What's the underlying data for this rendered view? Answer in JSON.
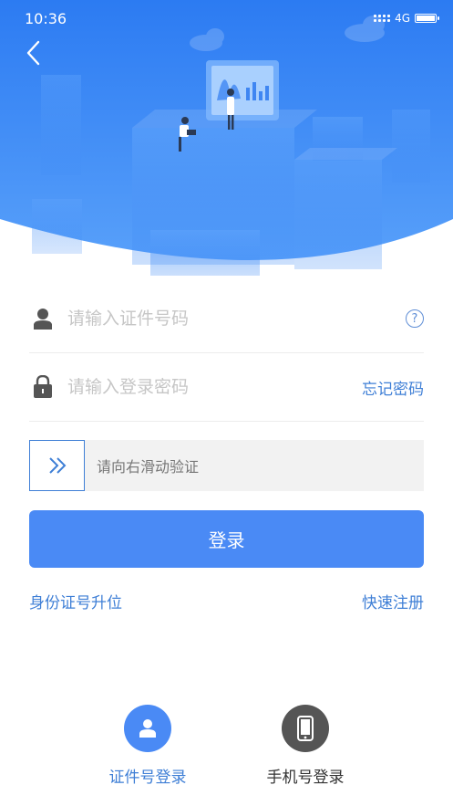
{
  "status_bar": {
    "time": "10:36",
    "network": "4G"
  },
  "colors": {
    "primary": "#4a8af5",
    "link": "#3f7fd6",
    "hero_top": "#2c7bf2",
    "hero_bottom": "#4f96f8"
  },
  "icons": {
    "back": "chevron-left-icon",
    "user": "user-icon",
    "lock": "lock-icon",
    "help": "question-icon",
    "slider": "double-chevron-right-icon",
    "cert_mode": "person-icon",
    "phone_mode": "phone-icon"
  },
  "form": {
    "id_placeholder": "请输入证件号码",
    "password_placeholder": "请输入登录密码",
    "help_glyph": "?",
    "forgot_password": "忘记密码"
  },
  "slider": {
    "text": "请向右滑动验证"
  },
  "login_button": "登录",
  "links": {
    "upgrade": "身份证号升位",
    "register": "快速注册"
  },
  "login_modes": {
    "cert": "证件号登录",
    "phone": "手机号登录"
  }
}
